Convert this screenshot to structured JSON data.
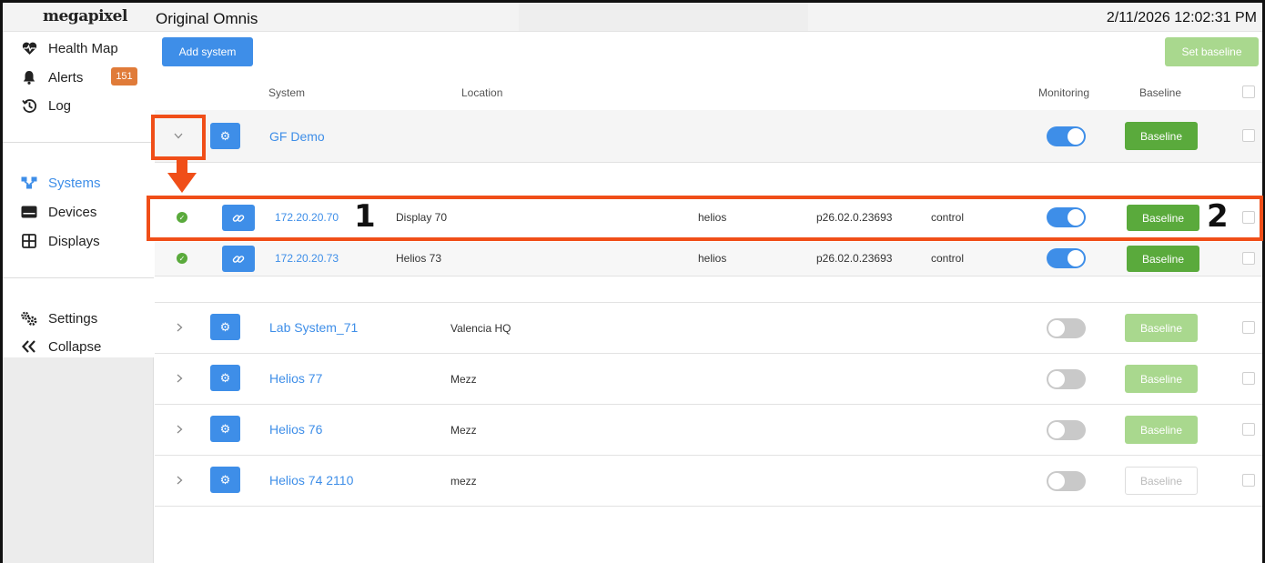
{
  "app": {
    "logo": "megapixel",
    "title": "Original Omnis",
    "datetime": "2/11/2026 12:02:31 PM"
  },
  "sidebar": {
    "items": [
      {
        "label": "Health Map",
        "icon": "heart-pulse-icon"
      },
      {
        "label": "Alerts",
        "icon": "bell-icon",
        "badge": "151"
      },
      {
        "label": "Log",
        "icon": "history-icon"
      },
      {
        "label": "Systems",
        "icon": "network-icon",
        "active": true
      },
      {
        "label": "Devices",
        "icon": "device-icon"
      },
      {
        "label": "Displays",
        "icon": "grid-icon"
      },
      {
        "label": "Settings",
        "icon": "gears-icon"
      },
      {
        "label": "Collapse",
        "icon": "double-chevron-left-icon"
      }
    ]
  },
  "toolbar": {
    "add_system": "Add system",
    "set_baseline": "Set baseline"
  },
  "table": {
    "headers": {
      "system": "System",
      "location": "Location",
      "monitoring": "Monitoring",
      "baseline": "Baseline"
    },
    "systems": [
      {
        "name": "GF Demo",
        "location": "",
        "monitoring": true,
        "baseline_label": "Baseline",
        "baseline_state": "active",
        "expanded": true
      },
      {
        "name": "Lab System_71",
        "location": "Valencia HQ",
        "monitoring": false,
        "baseline_label": "Baseline",
        "baseline_state": "disabled"
      },
      {
        "name": "Helios 77",
        "location": "Mezz",
        "monitoring": false,
        "baseline_label": "Baseline",
        "baseline_state": "disabled"
      },
      {
        "name": "Helios 76",
        "location": "Mezz",
        "monitoring": false,
        "baseline_label": "Baseline",
        "baseline_state": "disabled"
      },
      {
        "name": "Helios 74 2110",
        "location": "mezz",
        "monitoring": false,
        "baseline_label": "Baseline",
        "baseline_state": "outline"
      }
    ],
    "devices": [
      {
        "ip": "172.20.20.70",
        "name": "Display 70",
        "type": "helios",
        "version": "p26.02.0.23693",
        "role": "control",
        "monitoring": true,
        "baseline_label": "Baseline"
      },
      {
        "ip": "172.20.20.73",
        "name": "Helios 73",
        "type": "helios",
        "version": "p26.02.0.23693",
        "role": "control",
        "monitoring": true,
        "baseline_label": "Baseline"
      }
    ]
  },
  "annotations": {
    "one": "1",
    "two": "2"
  },
  "colors": {
    "accent": "#3e8ee8",
    "success": "#5aaa3c",
    "highlight": "#f04e18",
    "badge": "#e07b39"
  }
}
